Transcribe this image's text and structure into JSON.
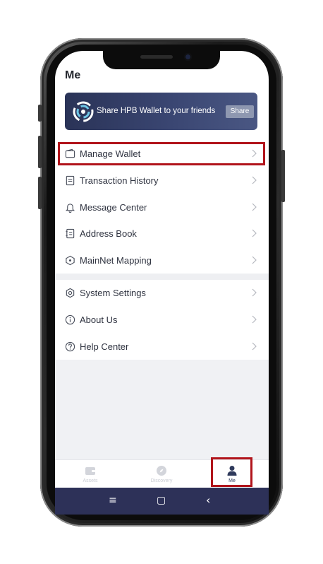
{
  "page": {
    "title": "Me"
  },
  "banner": {
    "text": "Share HPB Wallet to your friends",
    "share_label": "Share"
  },
  "menu_group_1": [
    {
      "label": "Manage Wallet",
      "icon": "wallet-icon"
    },
    {
      "label": "Transaction History",
      "icon": "document-icon"
    },
    {
      "label": "Message Center",
      "icon": "bell-icon"
    },
    {
      "label": "Address Book",
      "icon": "address-book-icon"
    },
    {
      "label": "MainNet Mapping",
      "icon": "mapping-icon"
    }
  ],
  "menu_group_2": [
    {
      "label": "System Settings",
      "icon": "settings-icon"
    },
    {
      "label": "About Us",
      "icon": "info-icon"
    },
    {
      "label": "Help Center",
      "icon": "help-icon"
    }
  ],
  "tabbar": {
    "tabs": [
      {
        "label": "Assets",
        "icon": "wallet-tab-icon",
        "active": false
      },
      {
        "label": "Discovery",
        "icon": "compass-icon",
        "active": false
      },
      {
        "label": "Me",
        "icon": "person-icon",
        "active": true
      }
    ]
  },
  "system_nav": {
    "menu": "≡",
    "home": "▢",
    "back": "‹"
  },
  "colors": {
    "highlight": "#b1141b",
    "banner": "#2a3357",
    "nav_bar": "#2d3158",
    "active_tab": "#2f3a5c"
  }
}
